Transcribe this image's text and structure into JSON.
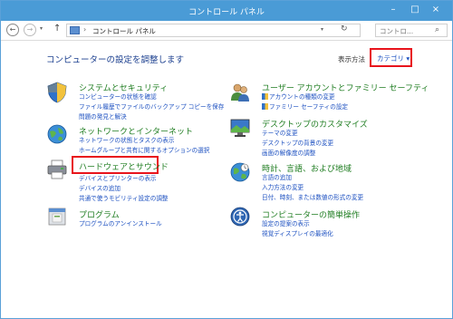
{
  "window": {
    "title": "コントロール パネル"
  },
  "nav": {
    "address": "コントロール パネル",
    "search_placeholder": "コントロ..."
  },
  "main": {
    "heading": "コンピューターの設定を調整します",
    "view_by_label": "表示方法",
    "view_by_value": "カテゴリ"
  },
  "categories": {
    "system": {
      "title": "システムとセキュリティ",
      "links": [
        "コンピューターの状態を確認",
        "ファイル履歴でファイルのバックアップ コピーを保存",
        "問題の発見と解決"
      ]
    },
    "network": {
      "title": "ネットワークとインターネット",
      "links": [
        "ネットワークの状態とタスクの表示",
        "ホームグループと共有に関するオプションの選択"
      ]
    },
    "hardware": {
      "title": "ハードウェアとサウンド",
      "links": [
        "デバイスとプリンターの表示",
        "デバイスの追加",
        "共通で使うモビリティ設定の調整"
      ]
    },
    "programs": {
      "title": "プログラム",
      "links": [
        "プログラムのアンインストール"
      ]
    },
    "user": {
      "title": "ユーザー アカウントとファミリー セーフティ",
      "links": [
        "アカウントの種類の変更",
        "ファミリー セーフティの設定"
      ]
    },
    "desktop": {
      "title": "デスクトップのカスタマイズ",
      "links": [
        "テーマの変更",
        "デスクトップの背景の変更",
        "画面の解像度の調整"
      ]
    },
    "clock": {
      "title": "時計、言語、および地域",
      "links": [
        "言語の追加",
        "入力方法の変更",
        "日付、時刻、または数値の形式の変更"
      ]
    },
    "access": {
      "title": "コンピューターの簡単操作",
      "links": [
        "設定の提案の表示",
        "視覚ディスプレイの最適化"
      ]
    }
  }
}
